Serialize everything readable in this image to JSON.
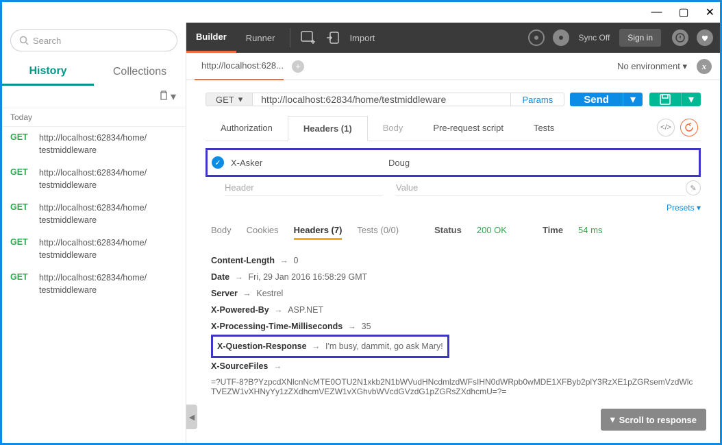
{
  "titlebar": {
    "min": "—",
    "max": "▢",
    "close": "✕"
  },
  "toolbar": {
    "builder": "Builder",
    "runner": "Runner",
    "import": "Import",
    "sync": "Sync Off",
    "signin": "Sign in"
  },
  "sidebar": {
    "search_placeholder": "Search",
    "tabs": {
      "history": "History",
      "collections": "Collections"
    },
    "section": "Today",
    "items": [
      {
        "method": "GET",
        "url": "http://localhost:62834/home/testmiddleware"
      },
      {
        "method": "GET",
        "url": "http://localhost:62834/home/testmiddleware"
      },
      {
        "method": "GET",
        "url": "http://localhost:62834/home/testmiddleware"
      },
      {
        "method": "GET",
        "url": "http://localhost:62834/home/testmiddleware"
      },
      {
        "method": "GET",
        "url": "http://localhost:62834/home/testmiddleware"
      }
    ]
  },
  "tabbar": {
    "active_tab": "http://localhost:628...",
    "env": "No environment"
  },
  "request": {
    "method": "GET",
    "url": "http://localhost:62834/home/testmiddleware",
    "params": "Params",
    "send": "Send"
  },
  "req_tabs": {
    "auth": "Authorization",
    "headers": "Headers (1)",
    "body": "Body",
    "pre": "Pre-request script",
    "tests": "Tests"
  },
  "req_headers": {
    "name": "X-Asker",
    "value": "Doug",
    "ph_name": "Header",
    "ph_value": "Value",
    "presets": "Presets"
  },
  "resp_tabs": {
    "body": "Body",
    "cookies": "Cookies",
    "headers": "Headers (7)",
    "tests": "Tests (0/0)",
    "status_lbl": "Status",
    "status": "200 OK",
    "time_lbl": "Time",
    "time": "54 ms"
  },
  "resp_headers": [
    {
      "name": "Content-Length",
      "value": "0"
    },
    {
      "name": "Date",
      "value": "Fri, 29 Jan 2016 16:58:29 GMT"
    },
    {
      "name": "Server",
      "value": "Kestrel"
    },
    {
      "name": "X-Powered-By",
      "value": "ASP.NET"
    },
    {
      "name": "X-Processing-Time-Milliseconds",
      "value": "35"
    },
    {
      "name": "X-Question-Response",
      "value": "I'm busy, dammit, go ask Mary!"
    },
    {
      "name": "X-SourceFiles",
      "value": ""
    }
  ],
  "resp_long": "=?UTF-8?B?YzpcdXNlcnNcMTE0OTU2N1xkb2N1bWVudHNcdmlzdWFsIHN0dWRpb0wMDE1XFByb2plY3RzXE1pZGRsemVzdWlcTVEZW1vXHNyYy1zZXdhcmVEZW1vXGhvbWVcdGVzdG1pZGRsZXdhcmU=?=",
  "scroll_btn": "Scroll to response"
}
